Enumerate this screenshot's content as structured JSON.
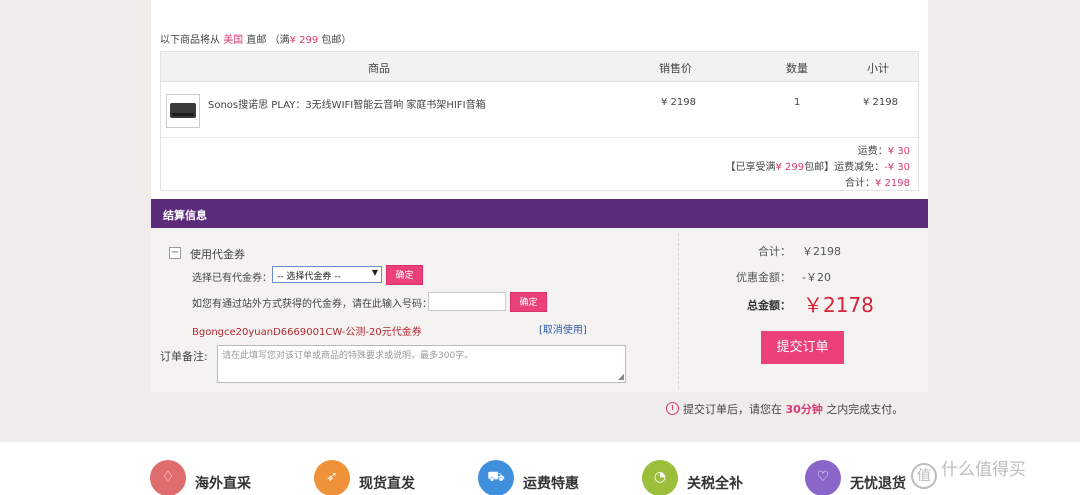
{
  "shipping_note": {
    "prefix": "以下商品将从",
    "country": "美国",
    "mode": "直邮",
    "condition_open": "（满",
    "threshold": "¥ 299",
    "condition_close": "包邮）"
  },
  "table": {
    "headers": {
      "product": "商品",
      "price": "销售价",
      "qty": "数量",
      "subtotal": "小计"
    },
    "item": {
      "name": "Sonos搜诺思 PLAY：3无线WIFI智能云音响 家庭书架HIFI音箱",
      "price": "¥ 2198",
      "qty": "1",
      "subtotal": "¥ 2198"
    },
    "summary": {
      "shipping_label": "运费：",
      "shipping_value": "¥ 30",
      "discount_prefix": "【已享受满",
      "discount_threshold": "¥ 299",
      "discount_mid": "包邮】运费减免：",
      "discount_value": "-¥ 30",
      "total_label": "合计：",
      "total_value": "¥ 2198"
    }
  },
  "settlement": {
    "title": "结算信息",
    "checkbox_mark": "−",
    "coupon_title": "使用代金券",
    "select_label": "选择已有代金券：",
    "select_value": "-- 选择代金券 --",
    "select_arrow": "▼",
    "confirm_label": "确定",
    "code_label": "如您有通过站外方式获得的代金券，请在此输入号码：",
    "applied_coupon": "Bgongce20yuanD6669001CW-公测-20元代金券",
    "cancel_link": "[取消使用]",
    "remark_label": "订单备注:",
    "remark_placeholder": "请在此填写您对该订单或商品的特殊要求或说明，最多300字。",
    "totals": {
      "sum_label": "合计：",
      "sum_value": "￥2198",
      "discount_label": "优惠金额：",
      "discount_value": "-￥20",
      "grand_label": "总金额：",
      "grand_value": "￥2178"
    },
    "submit_label": "提交订单"
  },
  "pay_note": {
    "prefix": "提交订单后，请您在",
    "time": "30分钟",
    "suffix": "之内完成支付。"
  },
  "features": [
    {
      "label": "海外直采",
      "icon": "bag-icon",
      "glyph": "♢",
      "color": "#e06d6d"
    },
    {
      "label": "现货直发",
      "icon": "rocket-icon",
      "glyph": "➶",
      "color": "#f0923a"
    },
    {
      "label": "运费特惠",
      "icon": "truck-icon",
      "glyph": "⛟",
      "color": "#3f8fdc"
    },
    {
      "label": "关税全补",
      "icon": "piggy-bank-icon",
      "glyph": "◔",
      "color": "#9bbf3a"
    },
    {
      "label": "无忧退货",
      "icon": "heart-shield-icon",
      "glyph": "♡",
      "color": "#8a66c8"
    }
  ],
  "watermark": {
    "icon_text": "值",
    "text": "什么值得买"
  }
}
